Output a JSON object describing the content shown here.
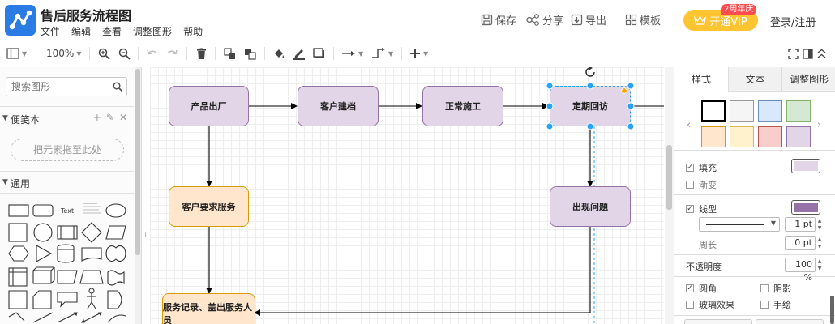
{
  "app": {
    "title": "售后服务流程图",
    "menu": [
      "文件",
      "编辑",
      "查看",
      "调整图形",
      "帮助"
    ],
    "actions": {
      "save": "保存",
      "share": "分享",
      "export": "导出",
      "template": "模板"
    },
    "vip": {
      "label": "开通VIP",
      "badge": "2周年庆"
    },
    "login": "登录/注册"
  },
  "toolbar": {
    "zoom": "100%"
  },
  "left_panel": {
    "search_placeholder": "搜索图形",
    "scratchpad_title": "便笺本",
    "drop_hint": "把元素拖至此处",
    "general_title": "通用",
    "text_shape_label": "Text"
  },
  "diagram": {
    "nodes": {
      "n1": "产品出厂",
      "n2": "客户建档",
      "n3": "正常施工",
      "n4": "定期回访",
      "n5": "客户要求服务",
      "n6": "出现问题",
      "n7": "服务记录、盖出服务人员"
    }
  },
  "right_panel": {
    "tabs": [
      "样式",
      "文本",
      "调整图形"
    ],
    "fill": "填充",
    "gradient": "渐变",
    "line": "线型",
    "line_width": "1 pt",
    "perimeter": "周长",
    "perimeter_value": "0 pt",
    "opacity": "不透明度",
    "opacity_value": "100 %",
    "rounded": "圆角",
    "shadow": "阴影",
    "glass": "玻璃效果",
    "sketch": "手绘"
  },
  "colors": {
    "accent": "#2a7be4",
    "node_purple_fill": "#e1d5e7",
    "node_purple_stroke": "#9673a6",
    "node_orange_fill": "#ffe6cc",
    "node_orange_stroke": "#d79b00",
    "selection": "#29a3f5",
    "vip": "#ffc531",
    "swatches": [
      "#ffffff",
      "#f5f5f5",
      "#dae8fc",
      "#d5e8d4",
      "#ffe6cc",
      "#fff2cc",
      "#f8cecc",
      "#e1d5e7"
    ]
  }
}
